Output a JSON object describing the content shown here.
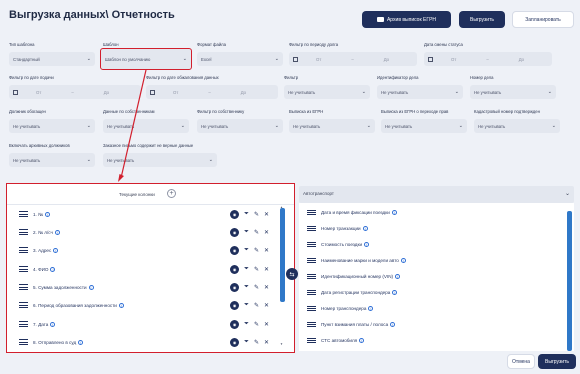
{
  "page": {
    "title": "Выгрузка данных\\ Отчетность"
  },
  "toolbar": {
    "archive_label": "Архив выписок ЕГРН",
    "export_label": "Выгрузить",
    "schedule_label": "Запланировать"
  },
  "filters": {
    "template_type": {
      "label": "Тип шаблона",
      "value": "Стандартный"
    },
    "template": {
      "label": "Шаблон",
      "value": "Шаблон по умолчанию"
    },
    "file_format": {
      "label": "Формат файла",
      "value": "Excel"
    },
    "debt_period": {
      "label": "Фильтр по периоду долга",
      "from": "От",
      "to": "До"
    },
    "status_date": {
      "label": "Дата смены статуса",
      "from": "От",
      "to": "До"
    },
    "filing_date": {
      "label": "Фильтр по дате подачи",
      "from": "От",
      "to": "До"
    },
    "appeal_date": {
      "label": "Фильтр по дате обжалования данных",
      "from": "От",
      "to": "До"
    },
    "fusion": {
      "label": "Фильтр",
      "value": "Не учитывать"
    },
    "case_id": {
      "label": "Идентификатор дела",
      "value": "Не учитывать"
    },
    "case_number": {
      "label": "Номер дела",
      "value": "Не учитывать"
    },
    "debtors": {
      "label": "Должник обогащен",
      "value": "Не учитывать"
    },
    "owners_data": {
      "label": "Данные по собственникам",
      "value": "Не учитывать"
    },
    "owner_filter": {
      "label": "Фильтр по собственнику",
      "value": "Не учитывать"
    },
    "egrn_extract": {
      "label": "Выписка из ЕГРН",
      "value": "Не учитывать"
    },
    "egrn_transfer": {
      "label": "Выписка из ЕГРН о переходе прав",
      "value": "Не учитывать"
    },
    "cadastral": {
      "label": "Кадастровый номер подтвержден",
      "value": "Не учитывать"
    },
    "archived": {
      "label": "Включать архивных должников",
      "value": "Не учитывать"
    },
    "wrong_data": {
      "label": "Заказное письмо содержит не верные данные",
      "value": "Не учитывать"
    }
  },
  "left_panel": {
    "header": "Текущие колонки",
    "columns": [
      "1. №",
      "2. № л/сч",
      "3. Адрес",
      "4. ФИО",
      "5. Сумма задолженности",
      "6. Период образования задолженности",
      "7. Дата",
      "8. Отправлено в суд"
    ]
  },
  "right_panel": {
    "header": "Автотранспорт",
    "items": [
      "Дата и время фиксации поездки",
      "Номер транзакции",
      "Стоимость поездки",
      "Наименование марки и модели авто",
      "Идентификационный номер (VIN)",
      "Дата регистрации транспондера",
      "Номер транспондера",
      "Пункт взимания платы / полоса",
      "СТС автомобиля"
    ]
  },
  "footer": {
    "cancel_label": "Отмена",
    "export_label": "Выгрузить"
  },
  "colors": {
    "primary": "#1f2f5c",
    "highlight": "#d21f2d",
    "accent": "#2f78c8"
  }
}
